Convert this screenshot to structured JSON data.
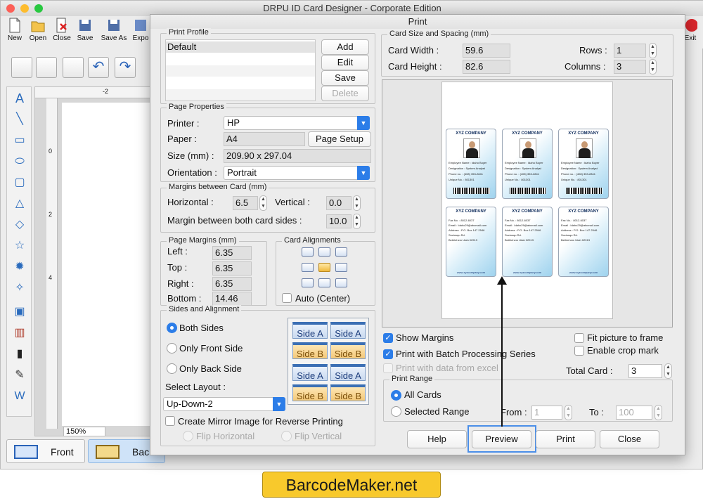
{
  "app": {
    "title": "DRPU ID Card Designer - Corporate Edition",
    "toolbar": [
      "New",
      "Open",
      "Close",
      "Save",
      "Save As",
      "Expo"
    ],
    "exit_label": "Exit",
    "zoom": "150%",
    "ruler_marks": [
      "-2",
      "0",
      "2",
      "4"
    ],
    "bottom_tabs": {
      "front": "Front",
      "back": "Back"
    }
  },
  "dialog": {
    "title": "Print",
    "print_profile": {
      "legend": "Print Profile",
      "items": [
        "Default",
        "",
        "",
        "",
        ""
      ],
      "buttons": {
        "add": "Add",
        "edit": "Edit",
        "save": "Save",
        "delete": "Delete"
      }
    },
    "page_properties": {
      "legend": "Page Properties",
      "printer_label": "Printer :",
      "printer_value": "HP",
      "paper_label": "Paper :",
      "paper_value": "A4",
      "page_setup": "Page Setup",
      "size_label": "Size (mm) :",
      "size_value": "209.90 x 297.04",
      "orientation_label": "Orientation :",
      "orientation_value": "Portrait"
    },
    "margins_between": {
      "legend": "Margins between Card (mm)",
      "horizontal_label": "Horizontal :",
      "horizontal_value": "6.5",
      "vertical_label": "Vertical :",
      "vertical_value": "0.0",
      "both_sides_label": "Margin between both card sides :",
      "both_sides_value": "10.0"
    },
    "page_margins": {
      "legend": "Page Margins (mm)",
      "left_label": "Left :",
      "left_value": "6.35",
      "top_label": "Top :",
      "top_value": "6.35",
      "right_label": "Right :",
      "right_value": "6.35",
      "bottom_label": "Bottom :",
      "bottom_value": "14.46"
    },
    "card_alignments": {
      "legend": "Card Alignments",
      "auto_center": "Auto (Center)"
    },
    "sides": {
      "legend": "Sides and Alignment",
      "both": "Both Sides",
      "front": "Only Front Side",
      "back": "Only Back Side",
      "layout_label": "Select Layout :",
      "layout_value": "Up-Down-2",
      "tiles": [
        "Side A",
        "Side A",
        "Side B",
        "Side B",
        "Side A",
        "Side A",
        "Side B",
        "Side B"
      ],
      "mirror": "Create Mirror Image for Reverse Printing",
      "flip_h": "Flip Horizontal",
      "flip_v": "Flip Vertical"
    },
    "card_size": {
      "legend": "Card Size and Spacing (mm)",
      "width_label": "Card Width :",
      "width_value": "59.6",
      "height_label": "Card Height :",
      "height_value": "82.6",
      "rows_label": "Rows :",
      "rows_value": "1",
      "columns_label": "Columns :",
      "columns_value": "3"
    },
    "preview_cards": {
      "company": "XYZ COMPANY",
      "front_lines": [
        "Employee Name : Idaho Boyer",
        "Designation : System Analyst",
        "Phone no. : (408) 353-2841",
        "Unique No. : 801301"
      ],
      "back_lines": [
        "Fax No. : 8012-6037",
        "Email : Idaho29@abcmail.com",
        "Address : P.O. Box 147 2546",
        "Sociosqu Rd.",
        "Bethlehem Utah 02913"
      ],
      "website": "www.xyzcompany.com"
    },
    "options": {
      "show_margins": "Show Margins",
      "batch": "Print with Batch Processing Series",
      "excel": "Print with data from excel",
      "fit_picture": "Fit picture to frame",
      "crop_mark": "Enable crop mark",
      "total_card_label": "Total Card :",
      "total_card_value": "3"
    },
    "print_range": {
      "legend": "Print Range",
      "all": "All Cards",
      "selected": "Selected Range",
      "from_label": "From :",
      "from_value": "1",
      "to_label": "To :",
      "to_value": "100"
    },
    "buttons": {
      "help": "Help",
      "preview": "Preview",
      "print": "Print",
      "close": "Close"
    }
  },
  "brand": "BarcodeMaker.net",
  "colors": {
    "accent": "#2c7de8",
    "brand_bg": "#f8c92c",
    "highlight": "#4a8ee8"
  }
}
